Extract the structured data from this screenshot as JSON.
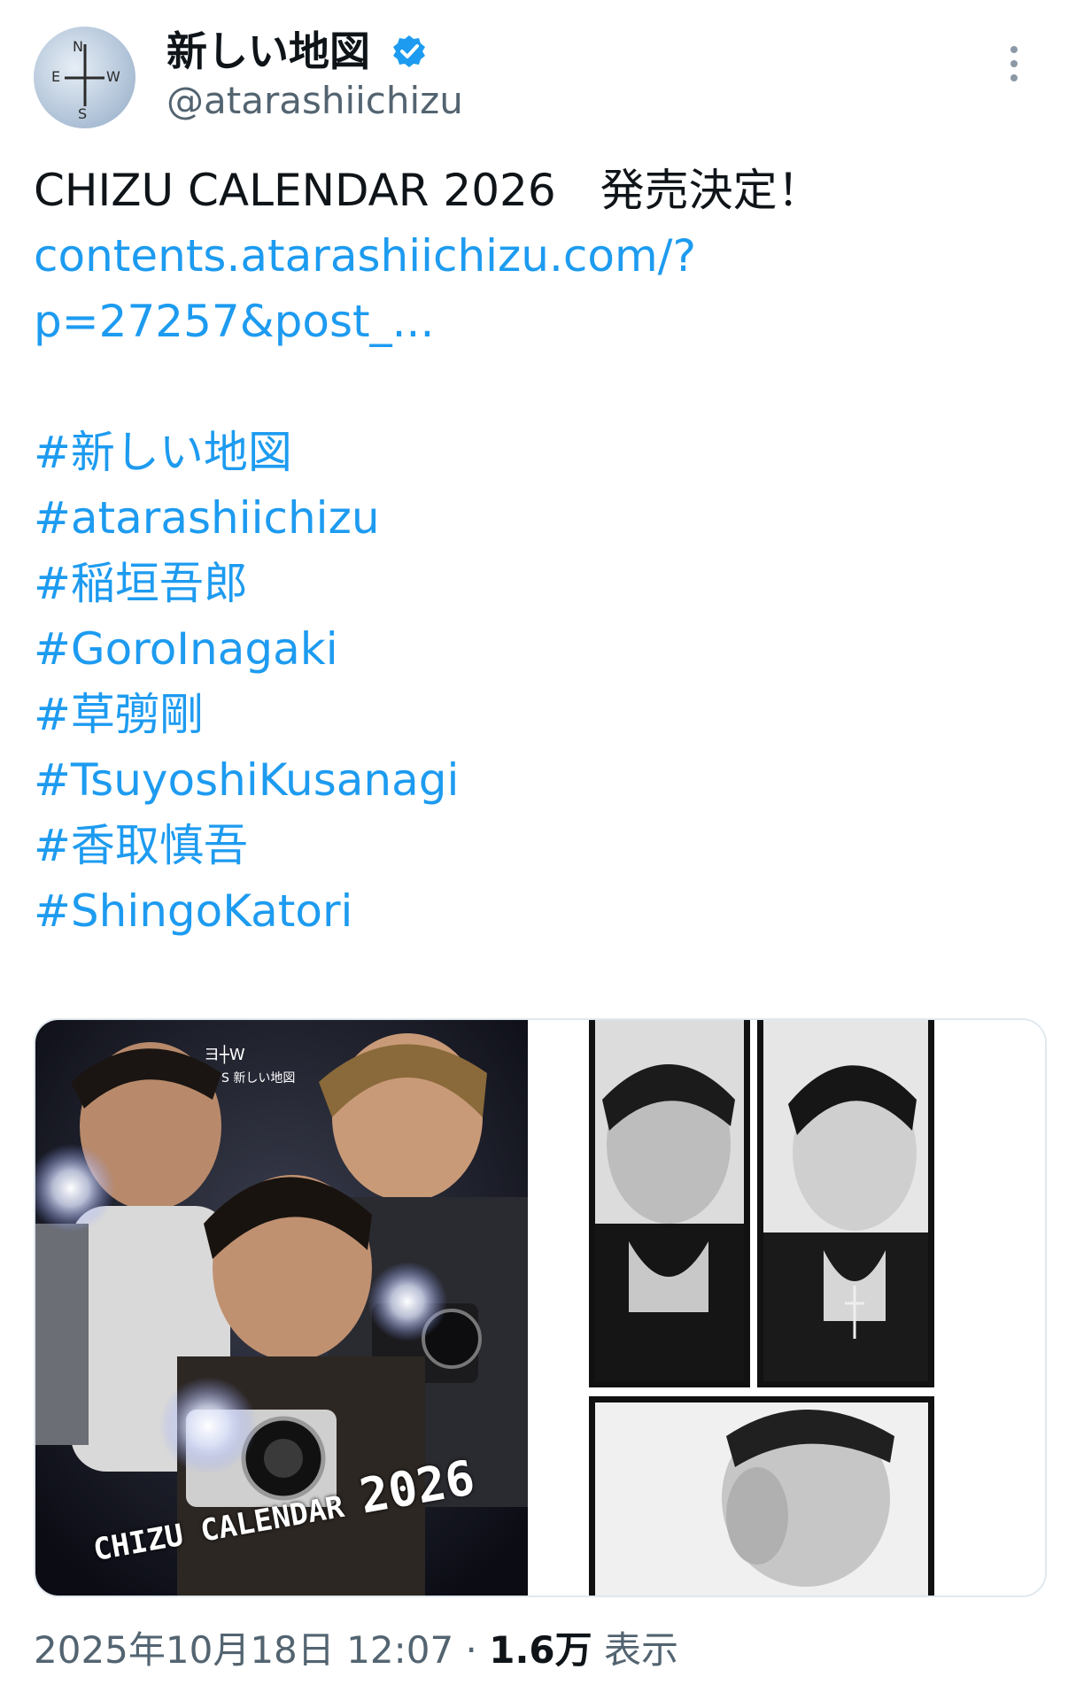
{
  "account": {
    "display_name": "新しい地図",
    "handle": "@atarashiichizu",
    "verified": true,
    "avatar_icon": "compass-logo-avatar"
  },
  "tweet": {
    "headline": "CHIZU CALENDAR 2026　発売決定！",
    "link_line1": "contents.atarashiichizu.com/?",
    "link_line2": "p=27257&post_...",
    "hashtags": [
      "#新しい地図",
      "#atarashiichizu",
      "#稲垣吾郎",
      "#GoroInagaki",
      "#草彅剛",
      "#TsuyoshiKusanagi",
      "#香取慎吾",
      "#ShingoKatori"
    ]
  },
  "media": {
    "left_image_caption": "CHIZU CALENDAR",
    "left_image_year": "2026"
  },
  "footer": {
    "timestamp": "2025年10月18日 12:07",
    "separator": "·",
    "views_count": "1.6万",
    "views_label": "表示"
  },
  "colors": {
    "link": "#1d9bf0",
    "secondary_text": "#536471",
    "verified_badge": "#1d9bf0"
  }
}
